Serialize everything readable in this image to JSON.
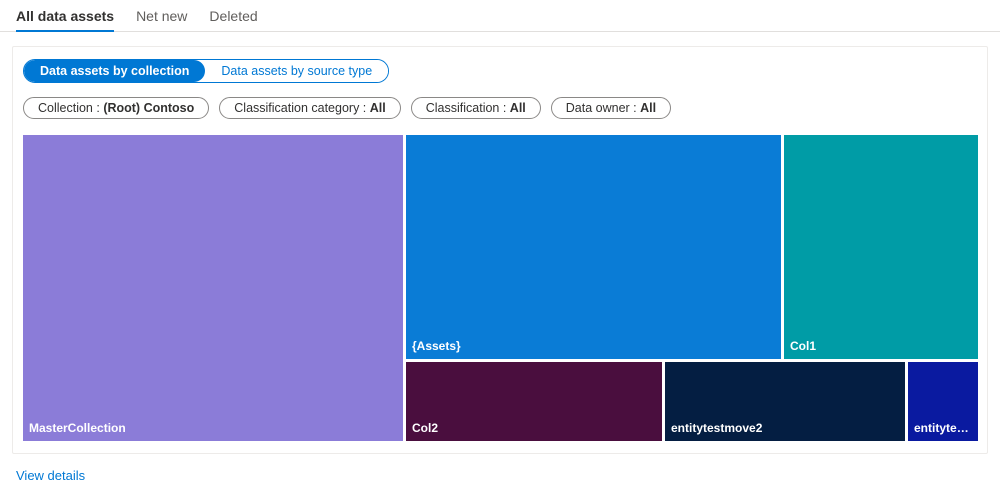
{
  "tabs": [
    {
      "label": "All data assets",
      "active": true
    },
    {
      "label": "Net new",
      "active": false
    },
    {
      "label": "Deleted",
      "active": false
    }
  ],
  "viewToggle": {
    "byCollection": "Data assets by collection",
    "bySourceType": "Data assets by source type"
  },
  "filters": {
    "collection": {
      "label": "Collection : ",
      "value": "(Root) Contoso"
    },
    "classificationCategory": {
      "label": "Classification category : ",
      "value": "All"
    },
    "classification": {
      "label": "Classification : ",
      "value": "All"
    },
    "dataOwner": {
      "label": "Data owner : ",
      "value": "All"
    }
  },
  "treemap": {
    "tiles": [
      {
        "name": "MasterCollection",
        "color": "#8b7cd8"
      },
      {
        "name": "{Assets}",
        "color": "#0a7cd6"
      },
      {
        "name": "Col1",
        "color": "#009ca6"
      },
      {
        "name": "Col2",
        "color": "#4a0e3e"
      },
      {
        "name": "entitytestmove2",
        "color": "#041e42"
      },
      {
        "name": "entitytestmov...",
        "color": "#0a1aa0"
      }
    ]
  },
  "chart_data": {
    "type": "area",
    "note": "treemap; values estimated from tile areas (relative proportions)",
    "categories": [
      "MasterCollection",
      "{Assets}",
      "Col1",
      "Col2",
      "entitytestmove2",
      "entitytestmove..."
    ],
    "values": [
      380,
      275,
      146,
      54,
      54,
      16
    ],
    "title": "Data assets by collection",
    "xlabel": "",
    "ylabel": "",
    "ylim": [
      0,
      400
    ]
  },
  "links": {
    "viewDetails": "View details"
  }
}
